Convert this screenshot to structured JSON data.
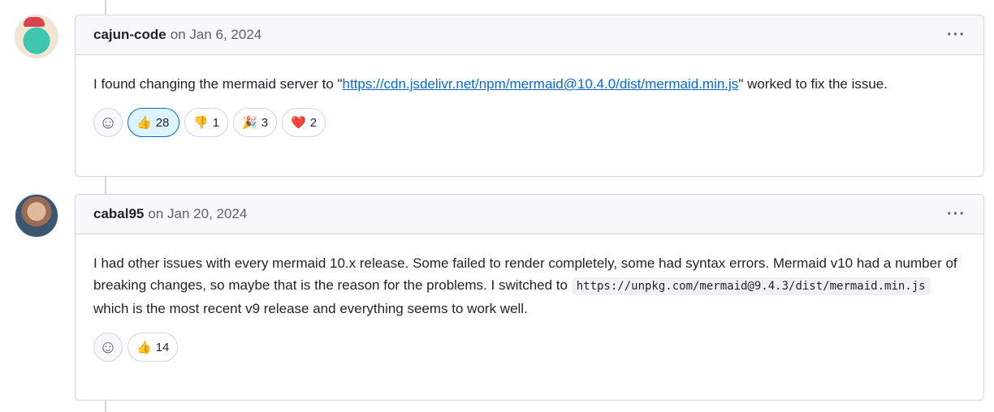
{
  "comments": [
    {
      "author": "cajun-code",
      "date": "on Jan 6, 2024",
      "text_before": "I found changing the mermaid server to \"",
      "link": "https://cdn.jsdelivr.net/npm/mermaid@10.4.0/dist/mermaid.min.js",
      "text_after": "\" worked to fix the issue.",
      "reactions": [
        {
          "emoji": "👍",
          "count": "28",
          "active": true
        },
        {
          "emoji": "👎",
          "count": "1"
        },
        {
          "emoji": "🎉",
          "count": "3"
        },
        {
          "emoji": "❤️",
          "count": "2"
        }
      ]
    },
    {
      "author": "cabal95",
      "date": "on Jan 20, 2024",
      "text_before": "I had other issues with every mermaid 10.x release. Some failed to render completely, some had syntax errors. Mermaid v10 had a number of breaking changes, so maybe that is the reason for the problems. I switched to ",
      "code": "https://unpkg.com/mermaid@9.4.3/dist/mermaid.min.js",
      "text_after": " which is the most recent v9 release and everything seems to work well.",
      "reactions": [
        {
          "emoji": "👍",
          "count": "14"
        }
      ]
    }
  ],
  "more_label": "···",
  "add_reaction_icon": "☺"
}
